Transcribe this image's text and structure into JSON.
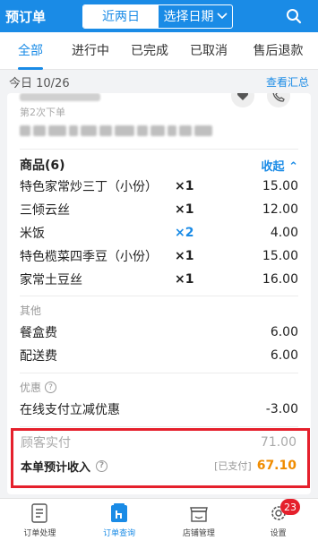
{
  "header": {
    "title": "预订单",
    "segment_active": "近两日",
    "segment_other": "选择日期"
  },
  "tabs": [
    "全部",
    "进行中",
    "已完成",
    "已取消",
    "售后退款"
  ],
  "date_row": {
    "date": "今日 10/26",
    "summary_link": "查看汇总"
  },
  "order": {
    "customer_sub": "第2次下单",
    "goods_header": "商品(6)",
    "collapse": "收起",
    "items": [
      {
        "name": "特色家常炒三丁（小份）",
        "qty": "×1",
        "price": "15.00",
        "highlight": false
      },
      {
        "name": "三倾云丝",
        "qty": "×1",
        "price": "12.00",
        "highlight": false
      },
      {
        "name": "米饭",
        "qty": "×2",
        "price": "4.00",
        "highlight": true
      },
      {
        "name": "特色榄菜四季豆（小份）",
        "qty": "×1",
        "price": "15.00",
        "highlight": false
      },
      {
        "name": "家常土豆丝",
        "qty": "×1",
        "price": "16.00",
        "highlight": false
      }
    ],
    "other_label": "其他",
    "box_fee_label": "餐盒费",
    "box_fee": "6.00",
    "delivery_fee_label": "配送费",
    "delivery_fee": "6.00",
    "discount_label": "优惠",
    "discount_name": "在线支付立减优惠",
    "discount_value": "-3.00",
    "customer_paid_label": "顾客实付",
    "customer_paid": "71.00",
    "income_label": "本单预计收入",
    "paid_status": "[已支付]",
    "income": "67.10"
  },
  "bottom_nav": [
    {
      "label": "订单处理"
    },
    {
      "label": "订单查询"
    },
    {
      "label": "店铺管理"
    },
    {
      "label": "设置",
      "badge": "23"
    }
  ],
  "colors": {
    "accent": "#1a8be6",
    "highlight_border": "#e5202c",
    "income": "#f08c00"
  }
}
